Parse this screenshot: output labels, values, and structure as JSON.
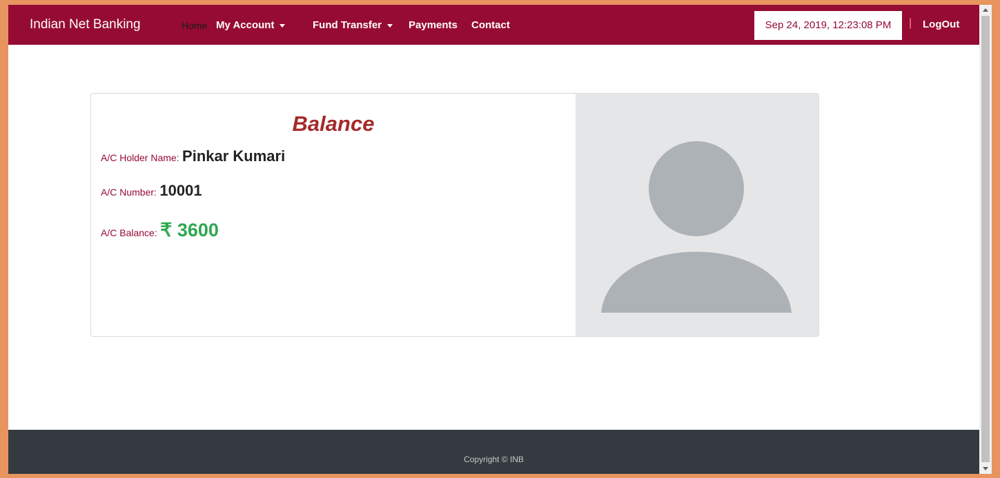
{
  "nav": {
    "brand": "Indian Net Banking",
    "items": [
      {
        "label": "Home"
      },
      {
        "label": "My Account"
      },
      {
        "label": "Fund Transfer"
      },
      {
        "label": "Payments"
      },
      {
        "label": "Contact"
      }
    ],
    "datetime": "Sep 24, 2019, 12:23:08 PM",
    "separator": "|",
    "logout": "LogOut"
  },
  "card": {
    "title": "Balance",
    "holder_label": "A/C Holder Name:",
    "holder_value": "Pinkar Kumari",
    "number_label": "A/C Number:",
    "number_value": "10001",
    "balance_label": "A/C Balance:",
    "balance_value": "₹ 3600"
  },
  "footer": {
    "text": "Copyright © INB"
  },
  "colors": {
    "navbar": "#960b33",
    "footer": "#343a40",
    "balance": "#2ea84f",
    "title": "#a52a2a"
  }
}
